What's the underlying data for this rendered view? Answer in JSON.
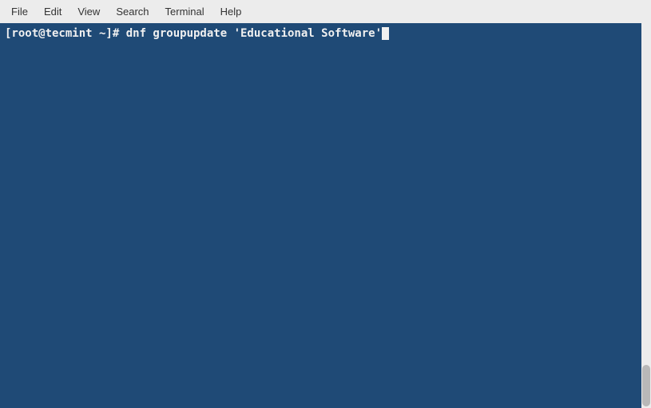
{
  "menubar": {
    "items": [
      {
        "label": "File"
      },
      {
        "label": "Edit"
      },
      {
        "label": "View"
      },
      {
        "label": "Search"
      },
      {
        "label": "Terminal"
      },
      {
        "label": "Help"
      }
    ]
  },
  "terminal": {
    "prompt": "[root@tecmint ~]# ",
    "command": "dnf groupupdate 'Educational Software'"
  }
}
